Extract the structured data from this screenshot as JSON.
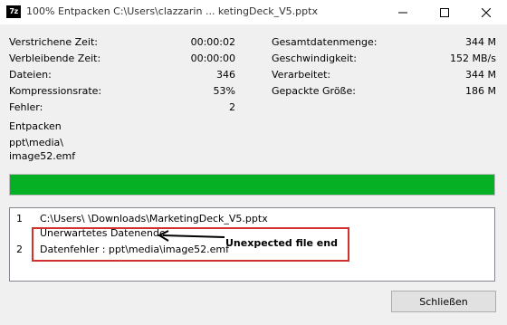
{
  "window": {
    "app_icon_text": "7z",
    "title": "100% Entpacken C:\\Users\\clazzarin ... ketingDeck_V5.pptx"
  },
  "stats_left": [
    {
      "label": "Verstrichene Zeit:",
      "value": "00:00:02"
    },
    {
      "label": "Verbleibende Zeit:",
      "value": "00:00:00"
    },
    {
      "label": "Dateien:",
      "value": "346"
    },
    {
      "label": "Kompressionsrate:",
      "value": "53%"
    },
    {
      "label": "Fehler:",
      "value": "2"
    }
  ],
  "stats_right": [
    {
      "label": "Gesamtdatenmenge:",
      "value": "344 M"
    },
    {
      "label": "Geschwindigkeit:",
      "value": "152 MB/s"
    },
    {
      "label": "Verarbeitet:",
      "value": "344 M"
    },
    {
      "label": "Gepackte Größe:",
      "value": "186 M"
    }
  ],
  "current": {
    "label": "Entpacken",
    "path_line1": "ppt\\media\\",
    "path_line2": "image52.emf"
  },
  "progress": {
    "percent": 100,
    "color": "#06b025"
  },
  "messages": [
    {
      "num": "1",
      "text": "C:\\Users\\        \\Downloads\\MarketingDeck_V5.pptx"
    },
    {
      "num": "",
      "text": "Unerwartetes Datenende"
    },
    {
      "num": "2",
      "text": "Datenfehler : ppt\\media\\image52.emf"
    }
  ],
  "annotation": {
    "text": "Unexpected file end",
    "box_color": "#d32f2f"
  },
  "buttons": {
    "close_label": "Schließen"
  }
}
